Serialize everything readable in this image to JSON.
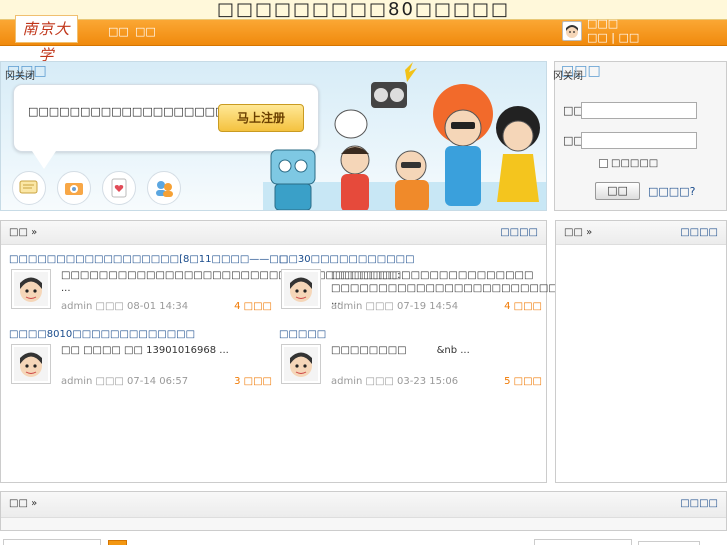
{
  "header": {
    "site_title": "□□□□□□□□□80□□□□□",
    "logo_text": "南京大学",
    "nav": [
      "□□",
      "□□"
    ],
    "user_name": "□□□",
    "user_link_1": "□□",
    "user_link_2": "□□",
    "separator": "|"
  },
  "banner": {
    "corner_mark": "冈关闭",
    "corner_deco": "□□□",
    "slogan": "□□□□□□□□□□□□□□□□□□□□□□……",
    "register_button": "马上注册",
    "icons": [
      "message-icon",
      "camera-icon",
      "heart-card-icon",
      "people-icon"
    ]
  },
  "login": {
    "corner_mark": "冈关闭",
    "corner_deco": "□□□",
    "username_label": "□□□",
    "password_label": "□□□",
    "remember_label": "□□□□□",
    "submit_button": "□□",
    "forgot_link": "□□□□?"
  },
  "posts_panel": {
    "title": "□□ »",
    "more": "□□□□",
    "posts": [
      {
        "title": "□□□□□□□□□□□□□□□□□□[8□11□□□□——□□",
        "excerpt": "□□□□□□□□□□□□□□□□□□□□□□□□□□□□□□□□□□□□□□□□□□□□□□□□□□ ...",
        "meta": "admin □□□ 08-01 14:34",
        "replies": "4 □□□"
      },
      {
        "title": "□□30□□□□□□□□□□□",
        "excerpt": "□□□□□□□:　　□□□□□□□□□□□□□□□□□□□□□□□□8 ...",
        "meta": "admin □□□ 07-19 14:54",
        "replies": "4 □□□"
      },
      {
        "title": "□□□□8010□□□□□□□□□□□□□",
        "excerpt": "□□ □□□□ □□ 13901016968 ...",
        "meta": "admin □□□ 07-14 06:57",
        "replies": "3 □□□"
      },
      {
        "title": "□□□□□",
        "excerpt": "□□□□□□□□　　　&nb ...",
        "meta": "admin □□□ 03-23 15:06",
        "replies": "5 □□□"
      }
    ]
  },
  "side_panel": {
    "title": "□□ »",
    "more": "□□□□"
  },
  "bottom_panel": {
    "title": "□□ »",
    "more": "□□□□"
  },
  "colors": {
    "accent": "#f39712",
    "link": "#1a4c8c",
    "replies": "#f07800"
  }
}
